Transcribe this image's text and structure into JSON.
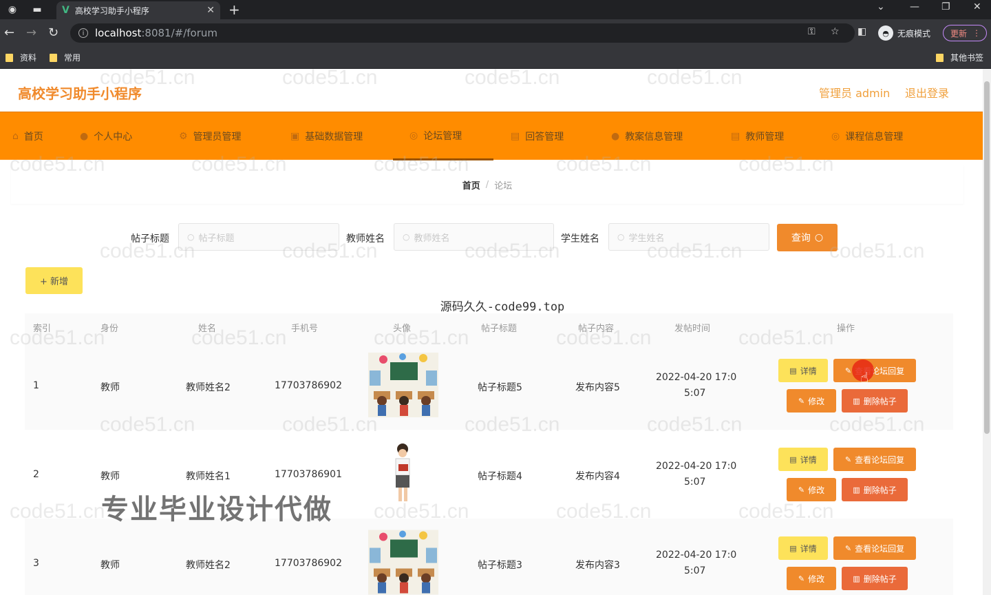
{
  "browser": {
    "tab_title": "高校学习助手小程序",
    "url_host": "localhost",
    "url_path": ":8081/#/forum",
    "incognito_label": "无痕模式",
    "update_label": "更新",
    "bookmarks": [
      "资料",
      "常用"
    ],
    "other_bookmarks": "其他书签"
  },
  "header": {
    "title": "高校学习助手小程序",
    "admin_label": "管理员 admin",
    "logout_label": "退出登录"
  },
  "menu": [
    {
      "label": "首页",
      "icon": "home-icon"
    },
    {
      "label": "个人中心",
      "icon": "user-icon"
    },
    {
      "label": "管理员管理",
      "icon": "admin-icon"
    },
    {
      "label": "基础数据管理",
      "icon": "data-icon"
    },
    {
      "label": "论坛管理",
      "icon": "forum-icon"
    },
    {
      "label": "回答管理",
      "icon": "answer-icon"
    },
    {
      "label": "教案信息管理",
      "icon": "lesson-icon"
    },
    {
      "label": "教师管理",
      "icon": "teacher-icon"
    },
    {
      "label": "课程信息管理",
      "icon": "course-icon"
    }
  ],
  "breadcrumb": {
    "home": "首页",
    "separator": "/",
    "current": "论坛"
  },
  "search": {
    "title_label": "帖子标题",
    "title_placeholder": "帖子标题",
    "teacher_label": "教师姓名",
    "teacher_placeholder": "教师姓名",
    "student_label": "学生姓名",
    "student_placeholder": "学生姓名",
    "query_label": "查询"
  },
  "add_label": "+ 新增",
  "overlay_title": "源码久久-code99.top",
  "overlay_promo": "专业毕业设计代做",
  "watermark": "code51.cn",
  "table": {
    "headers": [
      "索引",
      "身份",
      "姓名",
      "手机号",
      "头像",
      "帖子标题",
      "帖子内容",
      "发帖时间",
      "操作"
    ],
    "rows": [
      {
        "index": "1",
        "role": "教师",
        "name": "教师姓名2",
        "phone": "17703786902",
        "avatar": "classroom-image",
        "title": "帖子标题5",
        "content": "发布内容5",
        "time1": "2022-04-20 17:0",
        "time2": "5:07"
      },
      {
        "index": "2",
        "role": "教师",
        "name": "教师姓名1",
        "phone": "17703786901",
        "avatar": "teacher-image",
        "title": "帖子标题4",
        "content": "发布内容4",
        "time1": "2022-04-20 17:0",
        "time2": "5:07"
      },
      {
        "index": "3",
        "role": "教师",
        "name": "教师姓名2",
        "phone": "17703786902",
        "avatar": "classroom-image",
        "title": "帖子标题3",
        "content": "发布内容3",
        "time1": "2022-04-20 17:0",
        "time2": "5:07"
      }
    ],
    "actions": {
      "detail": "详情",
      "reply": "查看论坛回复",
      "edit": "修改",
      "delete": "删除帖子"
    }
  },
  "colors": {
    "accent": "#ff8c00",
    "title": "#f08a2c",
    "detail": "#fde25a",
    "delete": "#ea6a3a"
  }
}
